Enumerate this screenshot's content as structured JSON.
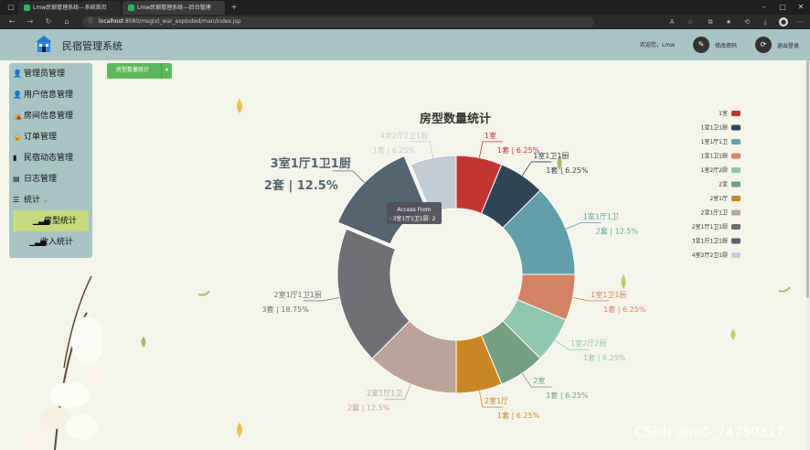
{
  "browser": {
    "tabs": [
      {
        "title": "Lmw民宿管理系统---系统首页",
        "active": false
      },
      {
        "title": "Lmw民宿管理系统---后台管理",
        "active": true
      }
    ],
    "url_host": "localhost",
    "url_path": ":8080/msglxt_war_exploded/man/index.jsp",
    "new_tab": "+"
  },
  "header": {
    "title": "民宿管理系统",
    "welcome": "欢迎您，Lmw",
    "change_password": "修改密码",
    "logout": "退出登录"
  },
  "sidebar": {
    "items": [
      {
        "label": "管理员管理",
        "icon": "user-icon"
      },
      {
        "label": "用户信息管理",
        "icon": "user-icon"
      },
      {
        "label": "房间信息管理",
        "icon": "bed-icon"
      },
      {
        "label": "订单管理",
        "icon": "lock-icon"
      },
      {
        "label": "民宿动态管理",
        "icon": "book-icon"
      },
      {
        "label": "日志管理",
        "icon": "log-icon"
      },
      {
        "label": "统计",
        "icon": "list-icon",
        "expanded": true
      }
    ],
    "sub_items": [
      {
        "label": "房型统计",
        "active": true
      },
      {
        "label": "收入统计",
        "active": false
      }
    ]
  },
  "toolbar": {
    "dropdown_label": "房型数量统计"
  },
  "tooltip": {
    "title": "Access From",
    "text": "3室1厅1卫1厨: 2"
  },
  "chart_data": {
    "type": "pie",
    "variant": "donut",
    "title": "房型数量统计",
    "legend_position": "right",
    "highlighted": "3室1厅1卫1厨",
    "slices": [
      {
        "name": "1室",
        "value": 1,
        "percent": "6.25%",
        "color": "#c23531",
        "label": "1套 | 6.25%"
      },
      {
        "name": "1室1卫1厨",
        "value": 1,
        "percent": "6.25%",
        "color": "#2f4554",
        "label": "1套 | 6.25%"
      },
      {
        "name": "1室1厅1卫",
        "value": 2,
        "percent": "12.5%",
        "color": "#61a0a8",
        "label": "2套 | 12.5%"
      },
      {
        "name": "1室1卫1厨",
        "value": 1,
        "percent": "6.25%",
        "color": "#d48265",
        "label": "1套 | 6.25%"
      },
      {
        "name": "1室2厅2厨",
        "value": 1,
        "percent": "6.25%",
        "color": "#91c7ae",
        "label": "1套 | 6.25%"
      },
      {
        "name": "2室",
        "value": 1,
        "percent": "6.25%",
        "color": "#749f83",
        "label": "1套 | 6.25%"
      },
      {
        "name": "2室1厅",
        "value": 1,
        "percent": "6.25%",
        "color": "#ca8622",
        "label": "1套 | 6.25%"
      },
      {
        "name": "2室1厅1卫",
        "value": 2,
        "percent": "12.5%",
        "color": "#bda29a",
        "label": "2套 | 12.5%"
      },
      {
        "name": "2室1厅1卫1厨",
        "value": 3,
        "percent": "18.75%",
        "color": "#6e7074",
        "label": "3套 | 18.75%"
      },
      {
        "name": "3室1厅1卫1厨",
        "value": 2,
        "percent": "12.5%",
        "color": "#546570",
        "label": "2套 | 12.5%"
      },
      {
        "name": "4室2厅2卫1厨",
        "value": 1,
        "percent": "6.25%",
        "color": "#c4ccd3",
        "label": "1套 | 6.25%"
      }
    ]
  },
  "watermark": "CSDN @m0_74750317"
}
